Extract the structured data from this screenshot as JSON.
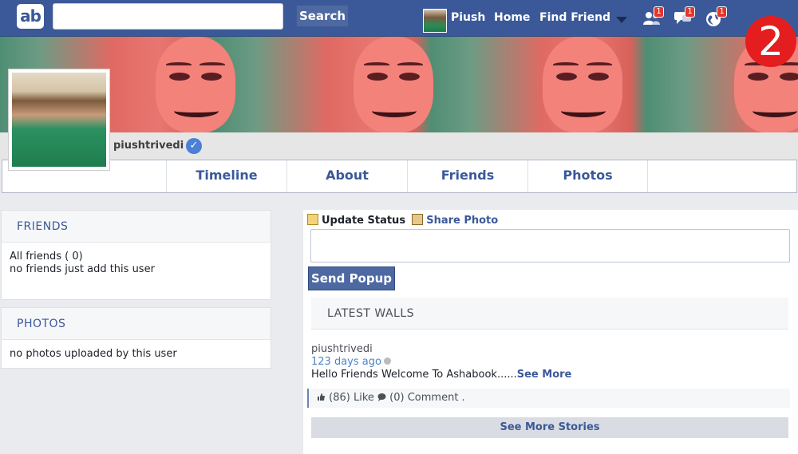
{
  "topbar": {
    "logo_text": "ab",
    "search_placeholder": "",
    "search_button": "Search",
    "user_name": "Piush",
    "home_link": "Home",
    "find_friend_link": "Find Friend",
    "notifications": {
      "friends_count": "1",
      "messages_count": "1",
      "globe_count": "1"
    },
    "colors": {
      "bar": "#3b5998",
      "badge": "#e4352b"
    }
  },
  "overlay_number": "2",
  "profile": {
    "username": "piushtrivedi",
    "verified_mark": "✓"
  },
  "tabs": [
    "Timeline",
    "About",
    "Friends",
    "Photos"
  ],
  "friends_panel": {
    "title": "FRIENDS",
    "count_line": "All friends ( 0)",
    "empty_text": "no friends just add this user"
  },
  "photos_panel": {
    "title": "PHOTOS",
    "empty_text": "no photos uploaded by this user"
  },
  "composer": {
    "update_status": "Update Status",
    "share_photo": "Share Photo",
    "textarea_value": "",
    "send_button": "Send Popup"
  },
  "walls": {
    "title": "LATEST WALLS",
    "post": {
      "author": "piushtrivedi",
      "time": "123 days ago",
      "text": "Hello Friends Welcome To Ashabook......",
      "see_more": "See More",
      "likes": "(86) Like",
      "comments": "(0) Comment ."
    },
    "see_more_stories": "See More Stories"
  }
}
